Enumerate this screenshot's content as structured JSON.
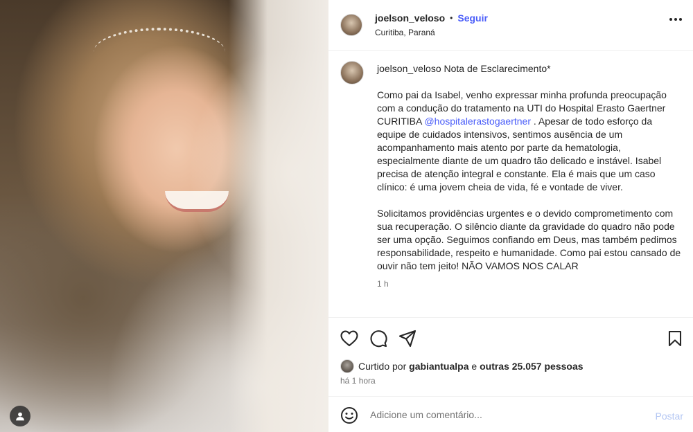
{
  "post": {
    "author": "joelson_veloso",
    "follow_label": "Seguir",
    "separator": "•",
    "location": "Curitiba, Paraná",
    "more_icon": "more-horizontal-icon"
  },
  "caption": {
    "author": "joelson_veloso",
    "title": "Nota de Esclarecimento*",
    "p1_before": "Como pai da Isabel, venho expressar minha profunda preocupação com a condução do tratamento na UTI do Hospital Erasto Gaertner CURITIBA ",
    "mention": "@hospitalerastogaertner",
    "p1_after": " . Apesar de todo esforço da equipe de cuidados intensivos, sentimos ausência de um acompanhamento mais atento por parte da hematologia, especialmente diante de um quadro tão delicado e instável. Isabel precisa de atenção integral e constante. Ela é mais que um caso clínico: é uma jovem cheia de vida, fé e vontade de viver.",
    "p2": "Solicitamos providências urgentes e o devido comprometimento com sua recuperação. O silêncio diante da gravidade do quadro não pode ser uma opção. Seguimos confiando em Deus, mas também pedimos responsabilidade, respeito e humanidade. Como pai estou cansado de ouvir não tem jeito! NÃO VAMOS NOS CALAR",
    "time": "1 h"
  },
  "actions": {
    "icons": [
      "heart-icon",
      "comment-icon",
      "share-icon",
      "bookmark-icon"
    ]
  },
  "likes": {
    "prefix": "Curtido por ",
    "user": "gabiantualpa",
    "middle": " e ",
    "others": "outras 25.057 pessoas"
  },
  "timestamp": "há 1 hora",
  "comment": {
    "placeholder": "Adicione um comentário...",
    "post_label": "Postar"
  },
  "colors": {
    "link": "#4a5df9",
    "post_disabled": "#b3c6f3",
    "secondary_text": "#737373"
  }
}
